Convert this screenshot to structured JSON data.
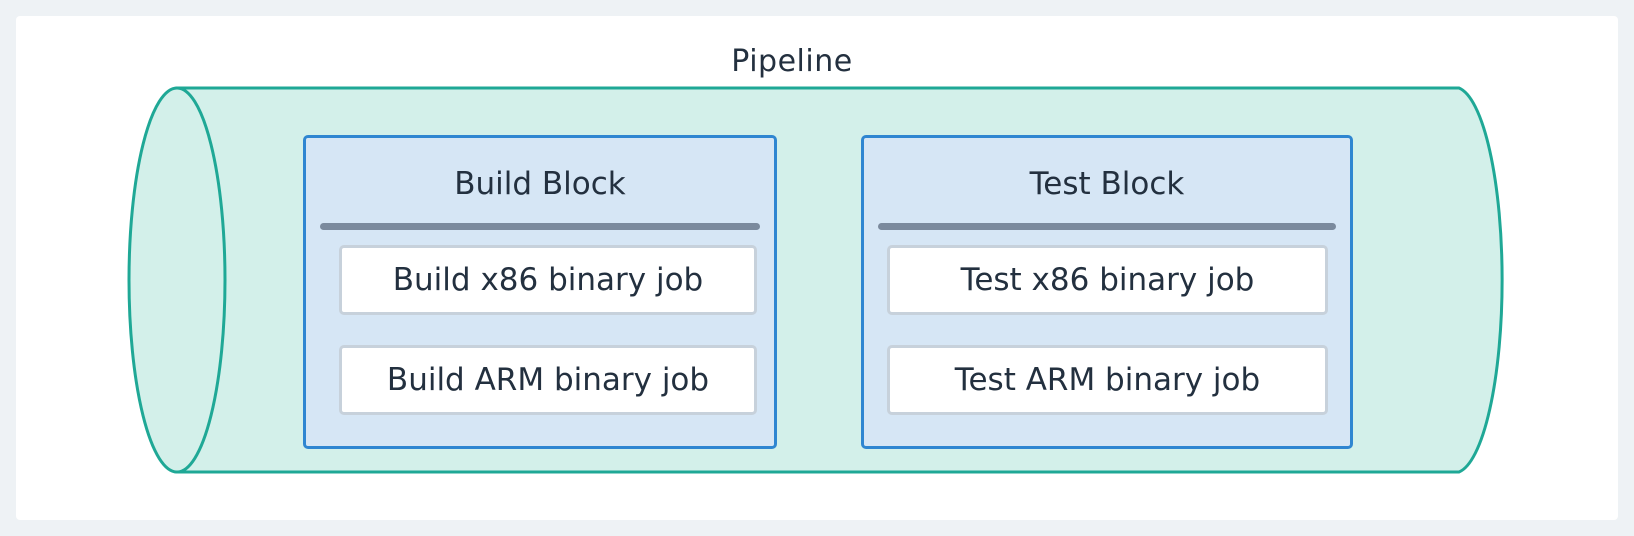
{
  "pipeline": {
    "title": "Pipeline",
    "colors": {
      "fill": "#d3f0ea",
      "stroke": "#1fa896"
    }
  },
  "blocks": [
    {
      "title": "Build Block",
      "jobs": [
        "Build x86 binary job",
        "Build ARM binary job"
      ]
    },
    {
      "title": "Test Block",
      "jobs": [
        "Test x86 binary job",
        "Test ARM binary job"
      ]
    }
  ]
}
